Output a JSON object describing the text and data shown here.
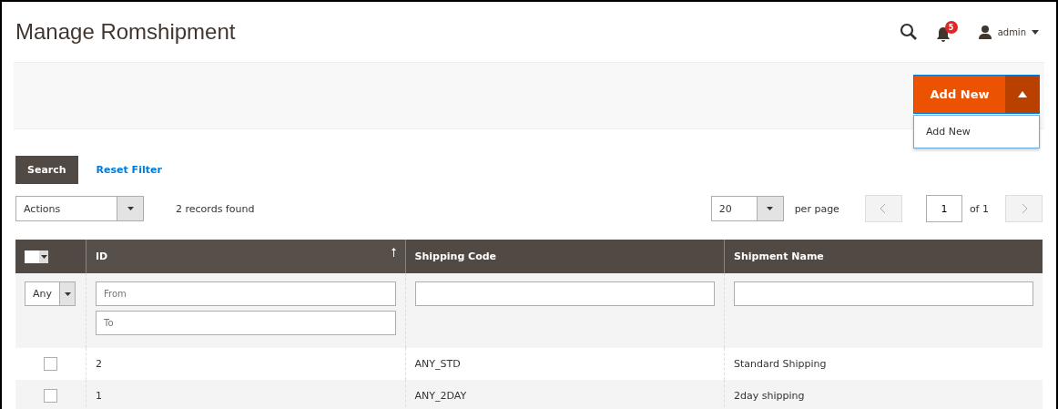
{
  "header": {
    "title": "Manage Romshipment",
    "notifications": "5",
    "user": "admin"
  },
  "add_button": {
    "label": "Add New",
    "expanded": true,
    "menu": [
      "Add New"
    ]
  },
  "search_button": "Search",
  "reset_filter": "Reset Filter",
  "actions": {
    "value": "Actions"
  },
  "records": "2 records found",
  "pager": {
    "per_page_value": "20",
    "per_page_label": "per page",
    "page": "1",
    "of": "of 1"
  },
  "table": {
    "columns": [
      {
        "label": "ID",
        "sorted": true
      },
      {
        "label": "Shipping Code",
        "sorted": false
      },
      {
        "label": "Shipment Name",
        "sorted": false
      }
    ],
    "mass_select": {
      "checked": false
    },
    "filters": {
      "any": "Any",
      "from": {
        "placeholder": "From"
      },
      "to": {
        "placeholder": "To"
      }
    },
    "rows": [
      {
        "checked": false,
        "cells": [
          "2",
          "ANY_STD",
          "Standard Shipping"
        ]
      },
      {
        "checked": false,
        "cells": [
          "1",
          "ANY_2DAY",
          "2day shipping"
        ]
      }
    ]
  }
}
